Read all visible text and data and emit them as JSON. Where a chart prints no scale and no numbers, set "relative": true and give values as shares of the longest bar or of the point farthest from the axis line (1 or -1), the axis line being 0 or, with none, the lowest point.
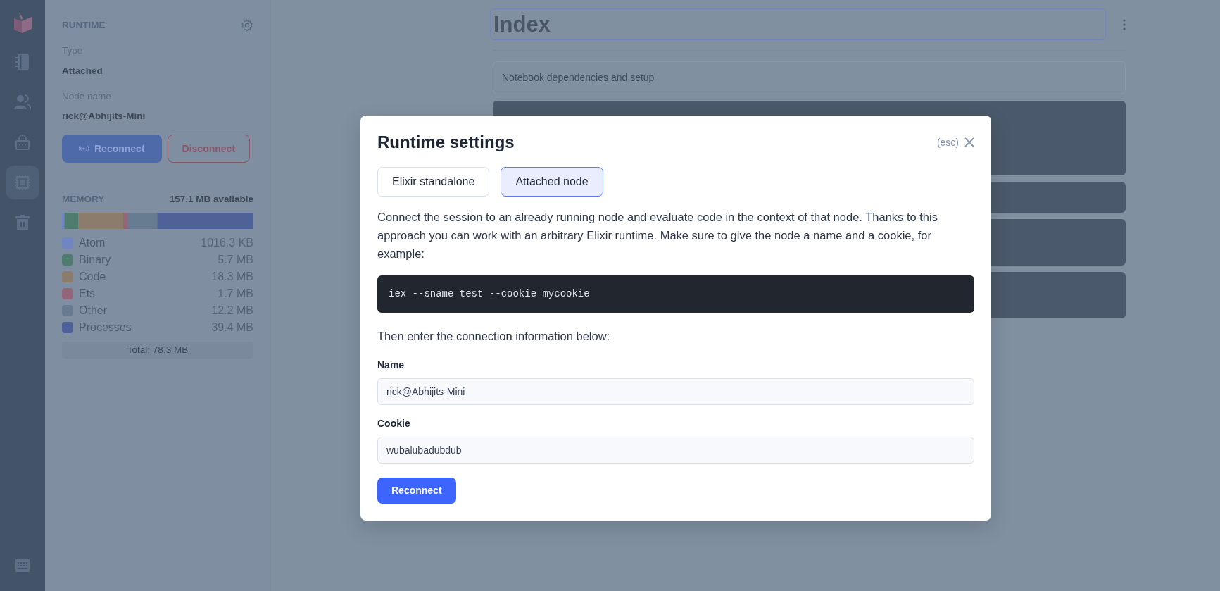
{
  "rail": {
    "items": [
      {
        "kind": "logo",
        "selected": false
      },
      {
        "kind": "notebook",
        "selected": false
      },
      {
        "kind": "users",
        "selected": false
      },
      {
        "kind": "lock",
        "selected": false
      },
      {
        "kind": "chip",
        "selected": true
      },
      {
        "kind": "trash",
        "selected": false
      },
      {
        "kind": "keyboard",
        "selected": false
      }
    ]
  },
  "runtime_panel": {
    "heading": "RUNTIME",
    "fields": [
      {
        "label": "Type",
        "value": "Attached"
      },
      {
        "label": "Node name",
        "value": "rick@Abhijits-Mini"
      }
    ],
    "buttons": [
      {
        "label": "Reconnect",
        "kind": "primary"
      },
      {
        "label": "Disconnect",
        "kind": "danger"
      }
    ],
    "memory": {
      "heading": "MEMORY",
      "available": "157.1 MB available",
      "total": "Total: 78.3 MB",
      "legend_values": [
        "1016.3 KB",
        "5.7 MB",
        "18.3 MB",
        "1.7 MB",
        "12.2 MB",
        "39.4 MB"
      ],
      "chart_data": {
        "type": "bar",
        "orientation": "horizontal",
        "stacked": true,
        "relative": true,
        "series": [
          {
            "name": "Atom",
            "color": "#6f85c4",
            "values": [
              0.013
            ]
          },
          {
            "name": "Binary",
            "color": "#4f7c6e",
            "values": [
              0.073
            ]
          },
          {
            "name": "Code",
            "color": "#8b7c6c",
            "values": [
              0.234
            ]
          },
          {
            "name": "Ets",
            "color": "#93667a",
            "values": [
              0.022
            ]
          },
          {
            "name": "Other",
            "color": "#677c90",
            "values": [
              0.156
            ]
          },
          {
            "name": "Processes",
            "color": "#4e6299",
            "values": [
              0.502
            ]
          }
        ]
      }
    }
  },
  "notebook": {
    "title": "Index",
    "setup_label": "Notebook dependencies and setup",
    "cells": [
      {
        "kind": "code"
      },
      {
        "kind": "markdown"
      },
      {
        "kind": "markdown"
      },
      {
        "kind": "markdown"
      }
    ]
  },
  "modal": {
    "title": "Runtime settings",
    "esc_hint": "(esc)",
    "tabs": [
      {
        "label": "Elixir standalone",
        "selected": false
      },
      {
        "label": "Attached node",
        "selected": true
      }
    ],
    "description": "Connect the session to an already running node and evaluate code in the context of that node. Thanks to this approach you can work with an arbitrary Elixir runtime. Make sure to give the node a name and a cookie, for example:",
    "command": "iex --sname test --cookie mycookie",
    "instruction": "Then enter the connection information below:",
    "fields": [
      {
        "label": "Name",
        "value": "rick@Abhijits-Mini"
      },
      {
        "label": "Cookie",
        "value": "wubalubadubdub"
      }
    ],
    "submit": "Reconnect"
  }
}
